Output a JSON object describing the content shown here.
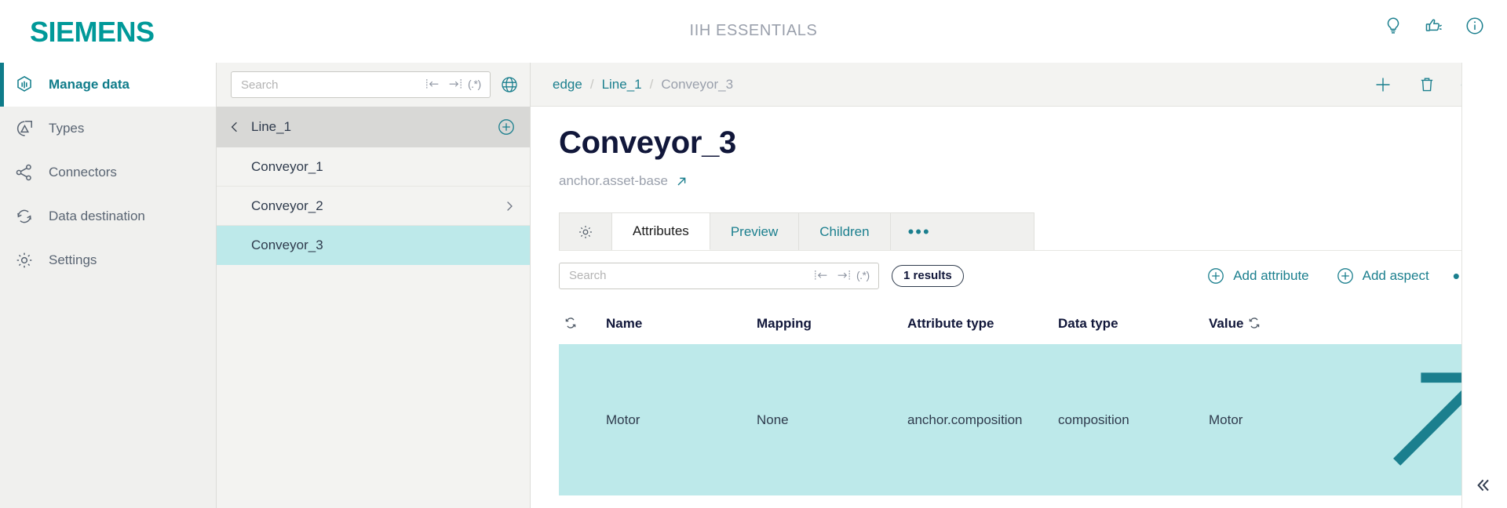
{
  "header": {
    "brand": "SIEMENS",
    "app_title": "IIH ESSENTIALS",
    "icons": [
      {
        "name": "lightbulb-icon",
        "label": "Tips"
      },
      {
        "name": "feedback-icon",
        "label": "Feedback"
      },
      {
        "name": "info-icon",
        "label": "Information"
      }
    ]
  },
  "sidebar": {
    "items": [
      {
        "label": "Manage data",
        "icon": "manage-data-icon",
        "active": true
      },
      {
        "label": "Types",
        "icon": "types-icon",
        "active": false
      },
      {
        "label": "Connectors",
        "icon": "connectors-icon",
        "active": false
      },
      {
        "label": "Data destination",
        "icon": "data-destination-icon",
        "active": false
      },
      {
        "label": "Settings",
        "icon": "settings-gear-icon",
        "active": false
      }
    ]
  },
  "tree": {
    "search": {
      "placeholder": "Search",
      "value": ""
    },
    "filters": {
      "starts_with": "|←",
      "ends_with": "→|",
      "regex": "(.*)"
    },
    "globe_icon": "globe-icon",
    "parent": {
      "label": "Line_1",
      "back_icon": "chevron-left-icon",
      "add_icon": "plus-circle-icon"
    },
    "nodes": [
      {
        "label": "Conveyor_1",
        "has_children": false,
        "selected": false
      },
      {
        "label": "Conveyor_2",
        "has_children": true,
        "selected": false
      },
      {
        "label": "Conveyor_3",
        "has_children": false,
        "selected": true
      }
    ]
  },
  "breadcrumb": {
    "items": [
      {
        "label": "edge",
        "current": false
      },
      {
        "label": "Line_1",
        "current": false
      },
      {
        "label": "Conveyor_3",
        "current": true
      }
    ],
    "separator": "/",
    "actions": [
      {
        "name": "add-icon",
        "label": "Add"
      },
      {
        "name": "delete-icon",
        "label": "Delete"
      },
      {
        "name": "more-options-icon",
        "label": "•••"
      }
    ]
  },
  "detail": {
    "title": "Conveyor_3",
    "subtitle": "anchor.asset-base",
    "subtitle_link_icon": "external-link-icon",
    "tabs": [
      {
        "label": "",
        "icon": "gear-icon",
        "active": false
      },
      {
        "label": "Attributes",
        "active": true
      },
      {
        "label": "Preview",
        "active": false
      },
      {
        "label": "Children",
        "active": false
      },
      {
        "label": "•••",
        "active": false
      }
    ]
  },
  "attributes": {
    "search": {
      "placeholder": "Search",
      "value": ""
    },
    "filters": {
      "starts_with": "|←",
      "ends_with": "→|",
      "regex": "(.*)"
    },
    "results_badge": "1 results",
    "add_attribute_label": "Add attribute",
    "add_aspect_label": "Add aspect",
    "more_label": "•••",
    "columns": [
      "Name",
      "Mapping",
      "Attribute type",
      "Data type",
      "Value"
    ],
    "rows": [
      {
        "name": "Motor",
        "mapping": "None",
        "attribute_type": "anchor.composition",
        "data_type": "composition",
        "value": "Motor",
        "selected": true,
        "actions": [
          "external-link-icon",
          "edit-pencil-icon",
          "delete-trash-icon",
          "more-options-icon"
        ]
      }
    ]
  },
  "footer": {
    "collapse_icon": "double-chevron-left-icon"
  },
  "colors": {
    "brand_teal": "#009999",
    "link_teal": "#1b7f8e",
    "selected_row": "#bde9ea",
    "title_navy": "#11173a"
  }
}
